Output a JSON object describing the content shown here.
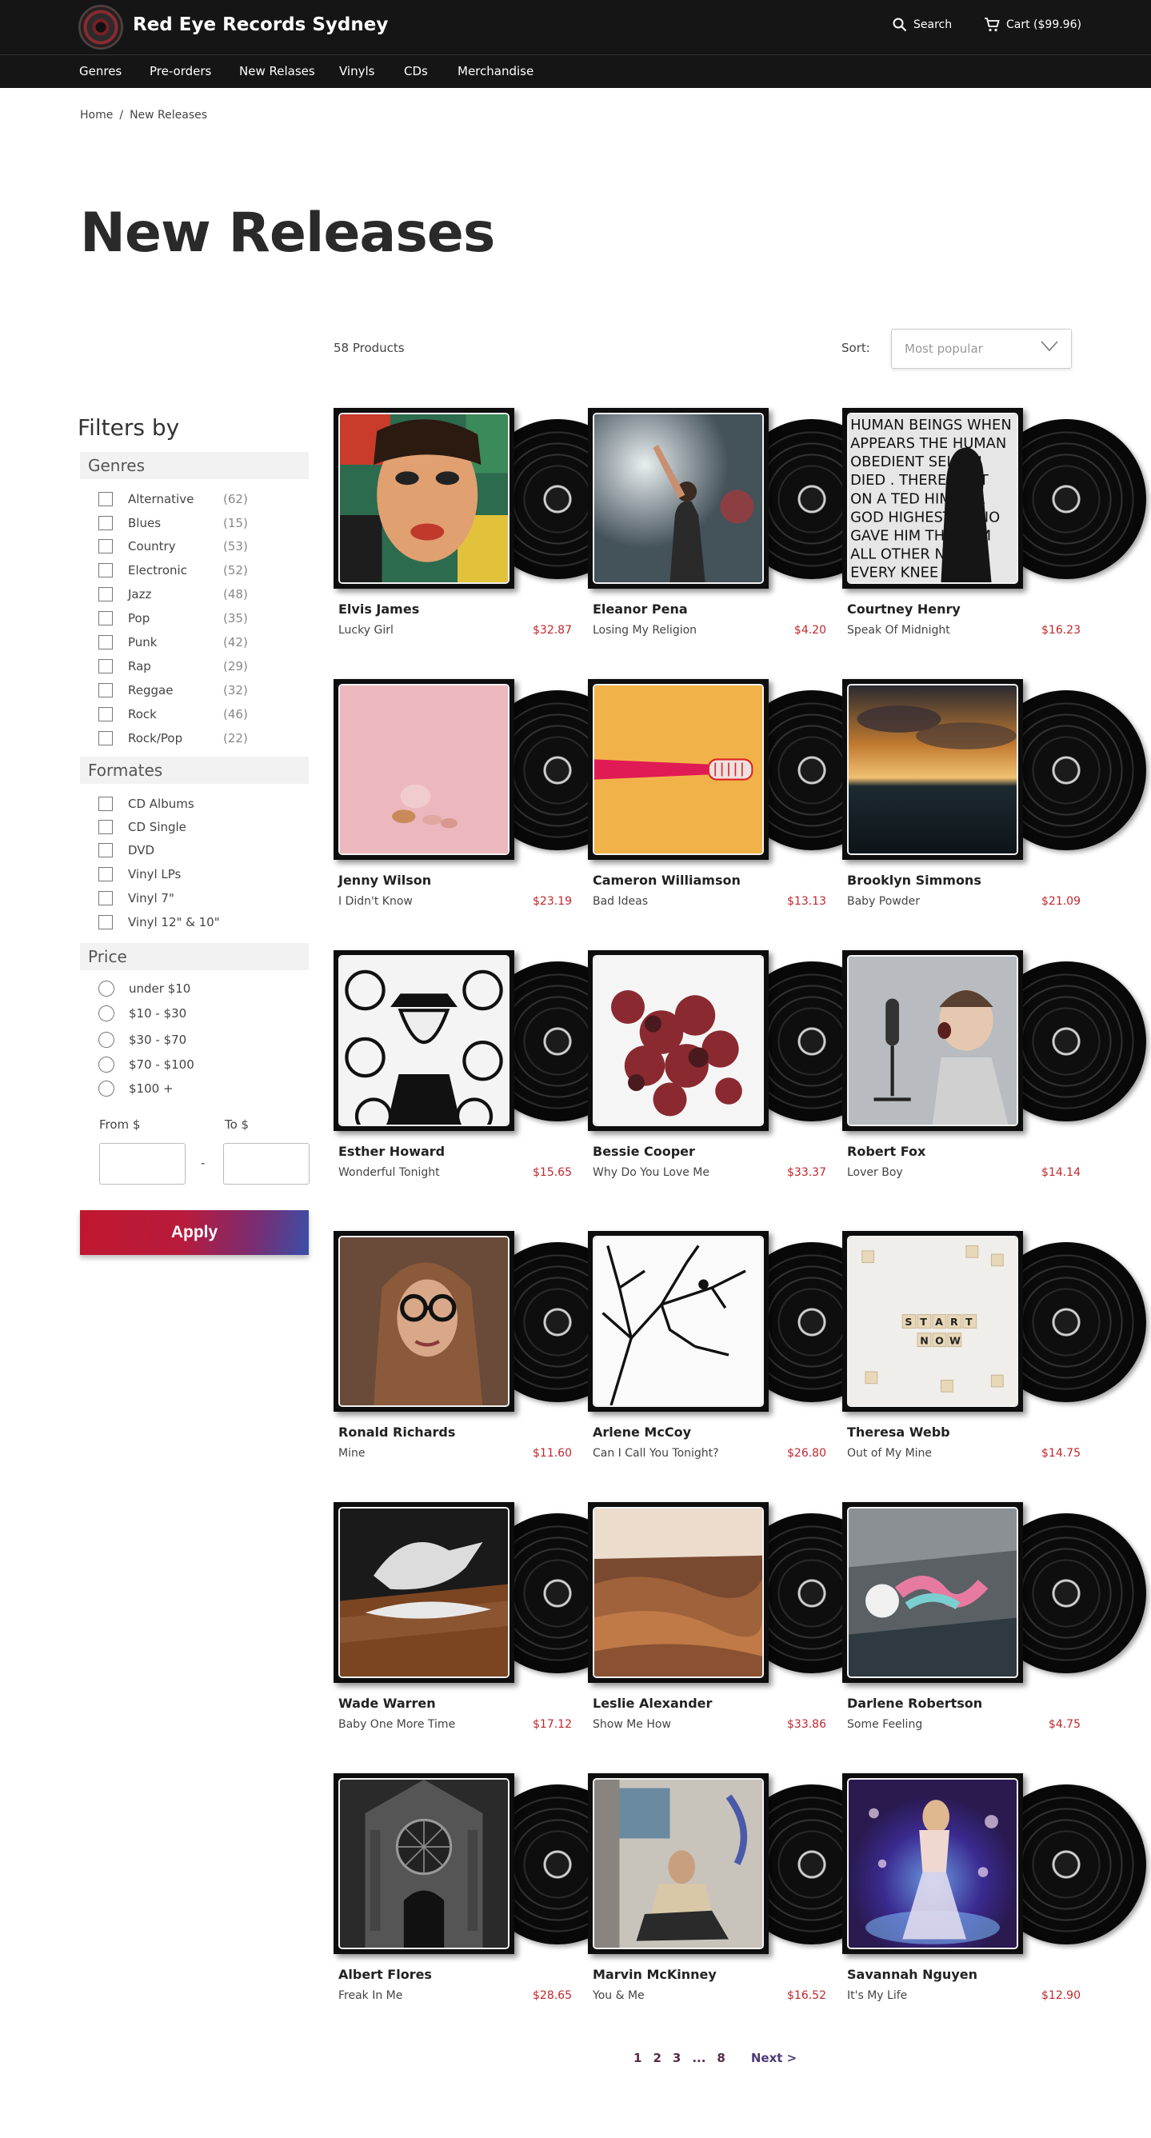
{
  "header": {
    "brand": "Red Eye Records Sydney",
    "search_label": "Search",
    "cart_label": "Cart ($99.96)"
  },
  "nav": [
    "Genres",
    "Pre-orders",
    "New Relases",
    "Vinyls",
    "CDs",
    "Merchandise"
  ],
  "breadcrumb": {
    "home": "Home",
    "sep": "/",
    "current": "New Releases"
  },
  "page_title": "New Releases",
  "toolbar": {
    "count": "58 Products",
    "sort_label": "Sort:",
    "sort_value": "Most popular"
  },
  "filters": {
    "title": "Filters by",
    "genres_title": "Genres",
    "genres": [
      {
        "label": "Alternative",
        "count": "(62)"
      },
      {
        "label": "Blues",
        "count": "(15)"
      },
      {
        "label": "Country",
        "count": "(53)"
      },
      {
        "label": "Electronic",
        "count": "(52)"
      },
      {
        "label": "Jazz",
        "count": "(48)"
      },
      {
        "label": "Pop",
        "count": "(35)"
      },
      {
        "label": "Punk",
        "count": "(42)"
      },
      {
        "label": "Rap",
        "count": "(29)"
      },
      {
        "label": "Reggae",
        "count": "(32)"
      },
      {
        "label": "Rock",
        "count": "(46)"
      },
      {
        "label": "Rock/Pop",
        "count": "(22)"
      }
    ],
    "formats_title": "Formates",
    "formats": [
      "CD Albums",
      "CD Single",
      "DVD",
      "Vinyl LPs",
      "Vinyl 7\"",
      "Vinyl 12\" & 10\""
    ],
    "price_title": "Price",
    "prices": [
      "under $10",
      "$10 - $30",
      "$30 - $70",
      "$70 - $100",
      "$100 +"
    ],
    "from_label": "From $",
    "to_label": "To $",
    "range_dash": "-",
    "apply_label": "Apply"
  },
  "products": [
    {
      "artist": "Elvis James",
      "title": "Lucky Girl",
      "price": "$32.87",
      "art": "portrait-colorful"
    },
    {
      "artist": "Eleanor Pena",
      "title": "Losing My Religion",
      "price": "$4.20",
      "art": "concert"
    },
    {
      "artist": "Courtney Henry",
      "title": "Speak Of Midnight",
      "price": "$16.23",
      "art": "text-wall"
    },
    {
      "artist": "Jenny Wilson",
      "title": "I Didn't Know",
      "price": "$23.19",
      "art": "pink-still"
    },
    {
      "artist": "Cameron Williamson",
      "title": "Bad Ideas",
      "price": "$13.13",
      "art": "toothbrush"
    },
    {
      "artist": "Brooklyn Simmons",
      "title": "Baby Powder",
      "price": "$21.09",
      "art": "sunset-sea"
    },
    {
      "artist": "Esther Howard",
      "title": "Wonderful Tonight",
      "price": "$15.65",
      "art": "stormtroopers"
    },
    {
      "artist": "Bessie Cooper",
      "title": "Why Do You Love Me",
      "price": "$33.37",
      "art": "red-leaves"
    },
    {
      "artist": "Robert Fox",
      "title": "Lover Boy",
      "price": "$14.14",
      "art": "shouting-boy"
    },
    {
      "artist": "Ronald Richards",
      "title": "Mine",
      "price": "$11.60",
      "art": "woman-glasses"
    },
    {
      "artist": "Arlene McCoy",
      "title": "Can I Call You Tonight?",
      "price": "$26.80",
      "art": "tree-silhouette"
    },
    {
      "artist": "Theresa Webb",
      "title": "Out of My Mine",
      "price": "$14.75",
      "art": "letter-tiles"
    },
    {
      "artist": "Wade Warren",
      "title": "Baby One More Time",
      "price": "$17.12",
      "art": "teapot"
    },
    {
      "artist": "Leslie Alexander",
      "title": "Show Me How",
      "price": "$33.86",
      "art": "canyon"
    },
    {
      "artist": "Darlene Robertson",
      "title": "Some Feeling",
      "price": "$4.75",
      "art": "graffiti-river"
    },
    {
      "artist": "Albert Flores",
      "title": "Freak In Me",
      "price": "$28.65",
      "art": "cathedral"
    },
    {
      "artist": "Marvin McKinney",
      "title": "You & Me",
      "price": "$16.52",
      "art": "man-sitting"
    },
    {
      "artist": "Savannah Nguyen",
      "title": "It's My Life",
      "price": "$12.90",
      "art": "dancer"
    }
  ],
  "pagination": [
    "1",
    "2",
    "3",
    "...",
    "8"
  ],
  "pagination_next": "Next >",
  "colors": {
    "header_bg": "#151515",
    "price": "#c0272d",
    "apply_start": "#c0172f",
    "apply_end": "#3a4fa8"
  },
  "text_wall_text": "HUMAN BEINGS WHEN HE APPEARS THE HUMAN SELF OBEDIENT DIED ... THERE CREATED HIM HIGHEST HONOR GAVE HIM THE NAME ALL OTHER NAMES AT THE NAME OF EVERY KNEE SHOULD",
  "tiles_text": "START NOW"
}
